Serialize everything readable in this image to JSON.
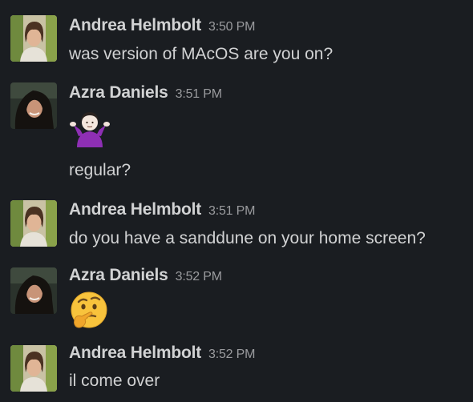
{
  "messages": [
    {
      "author": "Andrea Helmbolt",
      "time": "3:50 PM",
      "lines": [
        "was version of MAcOS are you on?"
      ]
    },
    {
      "author": "Azra Daniels",
      "time": "3:51 PM",
      "emoji": "person-shrugging-icon",
      "lines": [
        "regular?"
      ]
    },
    {
      "author": "Andrea Helmbolt",
      "time": "3:51 PM",
      "lines": [
        "do you have a sanddune on your home screen?"
      ]
    },
    {
      "author": "Azra Daniels",
      "time": "3:52 PM",
      "emoji": "thinking-face-icon"
    },
    {
      "author": "Andrea Helmbolt",
      "time": "3:52 PM",
      "lines": [
        "il come over"
      ]
    }
  ],
  "colors": {
    "background": "#1a1d21",
    "text": "#d1d2d3",
    "timestamp": "#9a9b9e"
  }
}
